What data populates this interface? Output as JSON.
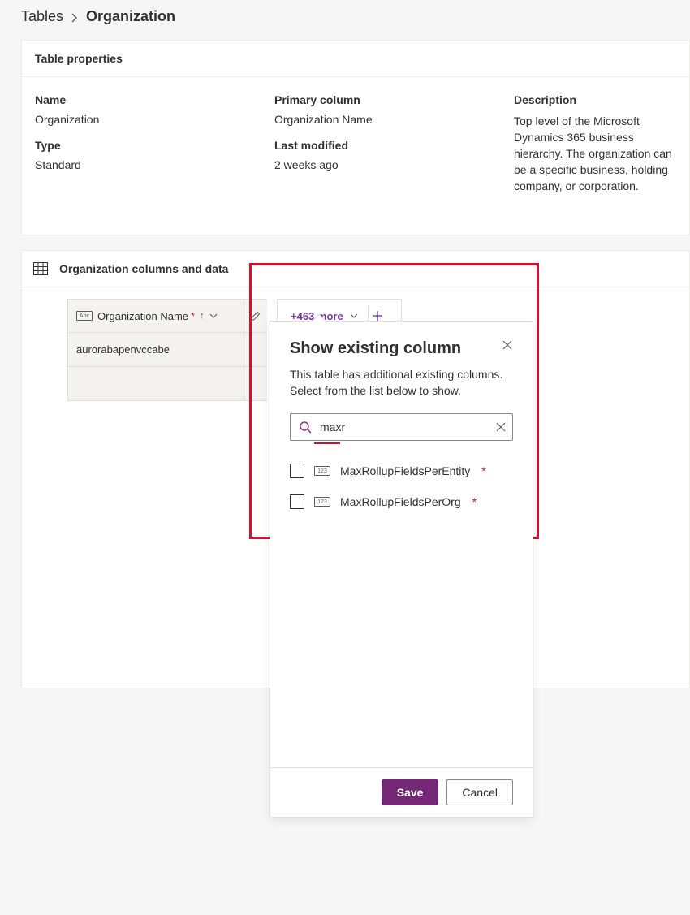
{
  "breadcrumb": {
    "root": "Tables",
    "current": "Organization"
  },
  "properties": {
    "header": "Table properties",
    "name_label": "Name",
    "name_value": "Organization",
    "type_label": "Type",
    "type_value": "Standard",
    "primary_label": "Primary column",
    "primary_value": "Organization Name",
    "modified_label": "Last modified",
    "modified_value": "2 weeks ago",
    "description_label": "Description",
    "description_value": "Top level of the Microsoft Dynamics 365 business hierarchy. The organization can be a specific business, holding company, or corporation."
  },
  "columns_section": {
    "header": "Organization columns and data",
    "column_header": "Organization Name",
    "more_label": "+463 more",
    "row_value": "aurorabapenvccabe"
  },
  "flyout": {
    "title": "Show existing column",
    "subtitle": "This table has additional existing columns. Select from the list below to show.",
    "search_value": "maxr",
    "options": [
      "MaxRollupFieldsPerEntity",
      "MaxRollupFieldsPerOrg"
    ],
    "save": "Save",
    "cancel": "Cancel"
  },
  "icons": {
    "abc": "Abc",
    "num": "123"
  }
}
